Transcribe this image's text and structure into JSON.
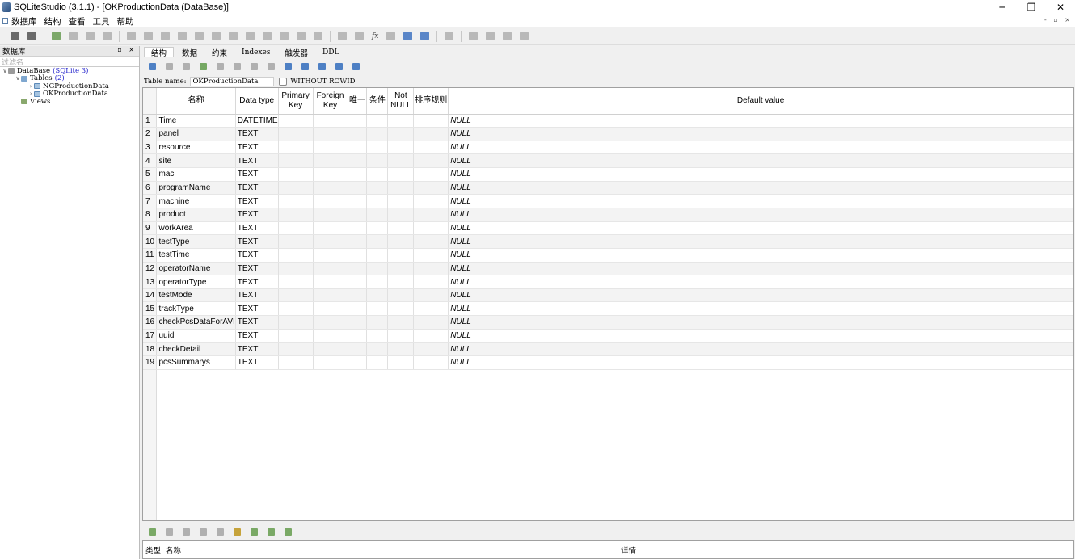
{
  "window": {
    "title": "SQLiteStudio (3.1.1) - [OKProductionData (DataBase)]",
    "minimize": "─",
    "restore": "❐",
    "close": "✕"
  },
  "menu": [
    "数据库",
    "结构",
    "查看",
    "工具",
    "帮助"
  ],
  "mdi_controls": "- ▫ ×",
  "left_panel": {
    "title": "数据库",
    "controls": "▫ ×",
    "filter_placeholder": "过滤名",
    "tree": {
      "db_name": "DataBase",
      "db_type": "(SQLite 3)",
      "tables_label": "Tables",
      "tables_count": "(2)",
      "tables": [
        "NGProductionData",
        "OKProductionData"
      ],
      "views_label": "Views"
    }
  },
  "tabs": [
    "结构",
    "数据",
    "约束",
    "Indexes",
    "触发器",
    "DDL"
  ],
  "table_name_label": "Table name:",
  "table_name_value": "OKProductionData",
  "without_rowid_label": "WITHOUT ROWID",
  "columns_headers": {
    "name": "名称",
    "data_type": "Data type",
    "primary_key": "Primary Key",
    "foreign_key": "Foreign Key",
    "unique": "唯一",
    "check": "条件",
    "not_null": "Not NULL",
    "collate": "排序规则",
    "default": "Default value"
  },
  "columns": [
    {
      "n": "1",
      "name": "Time",
      "type": "DATETIME",
      "default": "NULL"
    },
    {
      "n": "2",
      "name": "panel",
      "type": "TEXT",
      "default": "NULL"
    },
    {
      "n": "3",
      "name": "resource",
      "type": "TEXT",
      "default": "NULL"
    },
    {
      "n": "4",
      "name": "site",
      "type": "TEXT",
      "default": "NULL"
    },
    {
      "n": "5",
      "name": "mac",
      "type": "TEXT",
      "default": "NULL"
    },
    {
      "n": "6",
      "name": "programName",
      "type": "TEXT",
      "default": "NULL"
    },
    {
      "n": "7",
      "name": "machine",
      "type": "TEXT",
      "default": "NULL"
    },
    {
      "n": "8",
      "name": "product",
      "type": "TEXT",
      "default": "NULL"
    },
    {
      "n": "9",
      "name": "workArea",
      "type": "TEXT",
      "default": "NULL"
    },
    {
      "n": "10",
      "name": "testType",
      "type": "TEXT",
      "default": "NULL"
    },
    {
      "n": "11",
      "name": "testTime",
      "type": "TEXT",
      "default": "NULL"
    },
    {
      "n": "12",
      "name": "operatorName",
      "type": "TEXT",
      "default": "NULL"
    },
    {
      "n": "13",
      "name": "operatorType",
      "type": "TEXT",
      "default": "NULL"
    },
    {
      "n": "14",
      "name": "testMode",
      "type": "TEXT",
      "default": "NULL"
    },
    {
      "n": "15",
      "name": "trackType",
      "type": "TEXT",
      "default": "NULL"
    },
    {
      "n": "16",
      "name": "checkPcsDataForAVI",
      "type": "TEXT",
      "default": "NULL"
    },
    {
      "n": "17",
      "name": "uuid",
      "type": "TEXT",
      "default": "NULL"
    },
    {
      "n": "18",
      "name": "checkDetail",
      "type": "TEXT",
      "default": "NULL"
    },
    {
      "n": "19",
      "name": "pcsSummarys",
      "type": "TEXT",
      "default": "NULL"
    }
  ],
  "bottom_headers": {
    "type": "类型",
    "name": "名称",
    "details": "详情"
  }
}
